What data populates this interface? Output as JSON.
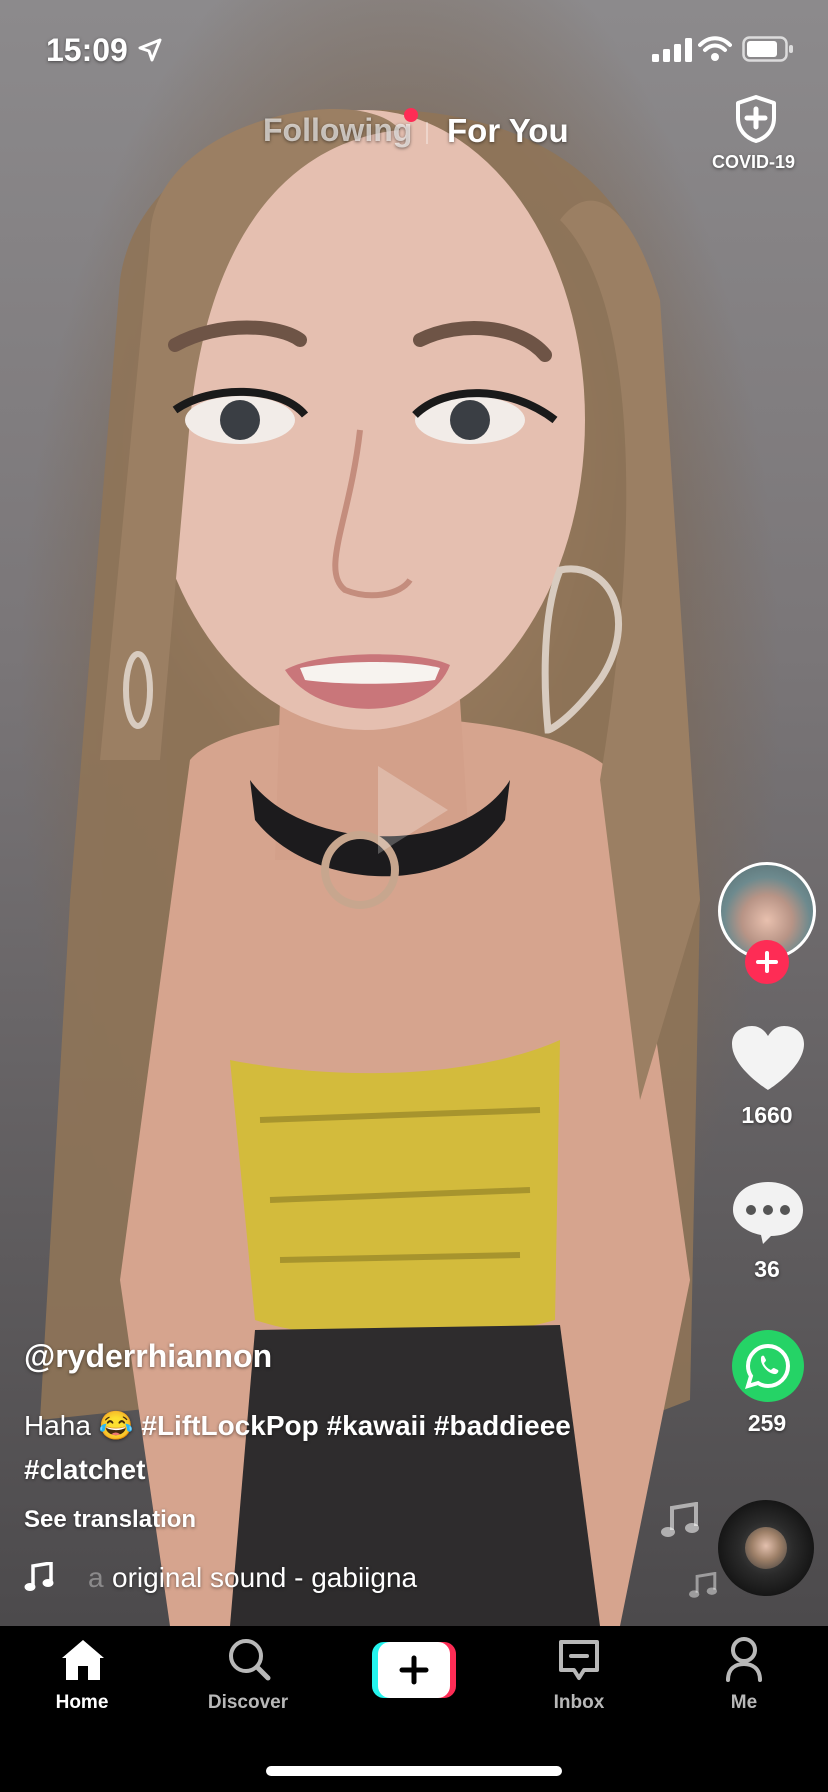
{
  "status_bar": {
    "time": "15:09"
  },
  "feed_tabs": {
    "following": "Following",
    "for_you": "For You"
  },
  "covid": {
    "label": "COVID-19"
  },
  "actions": {
    "likes": "1660",
    "comments": "36",
    "shares": "259"
  },
  "post": {
    "username": "@ryderrhiannon",
    "caption_prefix": "Haha",
    "caption_emoji": "😂",
    "hashtags_line1": "#LiftLockPop #kawaii #baddieee",
    "hashtags_line2": "#clatchet",
    "see_translation": "See translation",
    "sound_prefix": "a",
    "sound": "original sound - gabiigna"
  },
  "nav": {
    "home": "Home",
    "discover": "Discover",
    "inbox": "Inbox",
    "me": "Me"
  },
  "colors": {
    "accent_red": "#fe2c55",
    "accent_cyan": "#25f4ee",
    "whatsapp_green": "#25d366"
  }
}
